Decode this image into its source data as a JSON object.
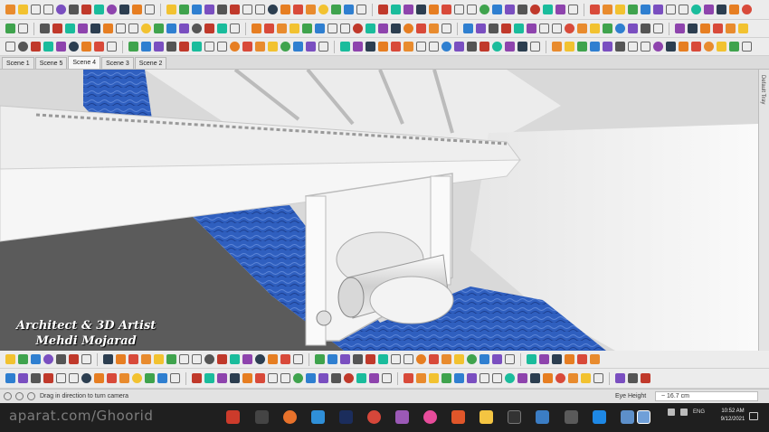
{
  "scenes": {
    "tabs": [
      {
        "label": "Scene 1"
      },
      {
        "label": "Scene 5"
      },
      {
        "label": "Scene 4"
      },
      {
        "label": "Scene 3"
      },
      {
        "label": "Scene 2"
      }
    ],
    "active_index": 2
  },
  "side_panel": {
    "label": "Default Tray"
  },
  "watermark": {
    "line1": "Architect & 3D Artist",
    "line2": "Mehdi Mojarad"
  },
  "status": {
    "hint": "Drag in direction to turn camera",
    "measure_label": "Eye Height",
    "measure_value": "~ 16.7 cm"
  },
  "taskbar": {
    "watermark": "aparat.com/Ghoorid",
    "tray_lang": "ENG",
    "time": "10:52 AM",
    "date": "9/12/2021"
  },
  "colors": {
    "water": "#2f5fbf",
    "water_dark": "#1d3f8f",
    "model_white": "#f2f2f2",
    "taskbar": "#1f1f1f",
    "toolbar": "#ececec",
    "active_tab": "#f7f7f7"
  },
  "icons": {
    "toolbar_top": "sketchup-tool-icons",
    "status_left": [
      "info-icon",
      "geo-icon",
      "user-icon"
    ],
    "taskbar": [
      "chrome-icon",
      "firefox-icon",
      "sketchup-icon",
      "photoshop-icon",
      "vscode-icon",
      "files-icon"
    ]
  }
}
